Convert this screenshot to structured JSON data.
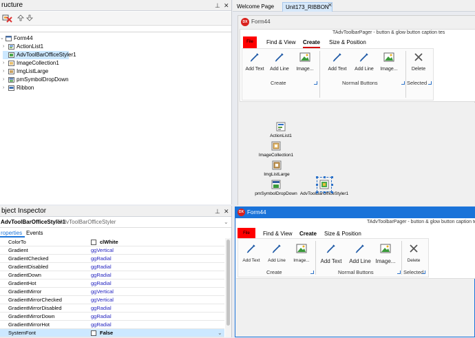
{
  "structure": {
    "title": "ructure",
    "toolbar_icons": [
      "add-icon",
      "delete-icon",
      "move-up-icon",
      "move-down-icon"
    ],
    "tree": [
      {
        "label": "Form44",
        "level": 0,
        "expand": "⌄",
        "icon": "form-icon"
      },
      {
        "label": "ActionList1",
        "level": 1,
        "expand": "›",
        "icon": "actionlist-icon"
      },
      {
        "label": "AdvToolBarOfficeStyler1",
        "level": 1,
        "expand": "",
        "icon": "styler-icon",
        "selected": true
      },
      {
        "label": "ImageCollection1",
        "level": 1,
        "expand": "›",
        "icon": "imagecollection-icon"
      },
      {
        "label": "ImgListLarge",
        "level": 1,
        "expand": "›",
        "icon": "imagelist-icon"
      },
      {
        "label": "pmSymbolDropDown",
        "level": 1,
        "expand": "›",
        "icon": "popupmenu-icon"
      },
      {
        "label": "Ribbon",
        "level": 1,
        "expand": "›",
        "icon": "ribbon-icon"
      }
    ]
  },
  "inspector": {
    "title": "bject Inspector",
    "selected_object": "AdvToolBarOfficeStyler1",
    "selected_type": "TAdvToolBarOfficeStyler",
    "tab_properties": "roperties",
    "tab_events": "Events",
    "rows": [
      {
        "name": "ColorTo",
        "value": "clWhite",
        "checkbox": true,
        "bold": true
      },
      {
        "name": "Gradient",
        "value": "ggVertical"
      },
      {
        "name": "GradientChecked",
        "value": "ggRadial"
      },
      {
        "name": "GradientDisabled",
        "value": "ggRadial"
      },
      {
        "name": "GradientDown",
        "value": "ggRadial"
      },
      {
        "name": "GradientHot",
        "value": "ggRadial"
      },
      {
        "name": "GradientMirror",
        "value": "ggVertical"
      },
      {
        "name": "GradientMirrorChecked",
        "value": "ggVertical"
      },
      {
        "name": "GradientMirrorDisabled",
        "value": "ggRadial"
      },
      {
        "name": "GradientMirrorDown",
        "value": "ggRadial"
      },
      {
        "name": "GradientMirrorHot",
        "value": "ggRadial"
      },
      {
        "name": "SystemFont",
        "value": "False",
        "checkbox": true,
        "bold": true,
        "selected": true
      }
    ]
  },
  "editor": {
    "tabs": [
      "Welcome Page",
      "Unit173_RIBBON"
    ],
    "active_tab": 1
  },
  "designer_form": {
    "title": "Form44",
    "pager_caption": "TAdvToolbarPager - button & glow button caption tes",
    "ribbon_tabs": [
      "File",
      "Find & View",
      "Create",
      "Size & Position"
    ],
    "active_ribbon_tab": "Create",
    "groups": [
      {
        "label": "Create",
        "buttons": [
          "Add Text",
          "Add Line",
          "Image..."
        ]
      },
      {
        "label": "Normal Buttons",
        "buttons": [
          "Add Text",
          "Add Line",
          "Image..."
        ]
      },
      {
        "label": "Selected",
        "buttons": [
          "Delete"
        ]
      }
    ],
    "nonvisual": [
      {
        "label": "ActionList1",
        "icon": "actionlist-icon"
      },
      {
        "label": "ImageCollection1",
        "icon": "imagecollection-icon"
      },
      {
        "label": "ImgListLarge",
        "icon": "imagelist-icon"
      },
      {
        "label": "pmSymbolDropDown",
        "icon": "popupmenu-icon"
      },
      {
        "label": "AdvToolBarOfficeStyler1",
        "icon": "styler-icon"
      }
    ]
  },
  "runtime_form": {
    "title": "Form44",
    "pager_caption": "TAdvToolbarPager - button & glow button caption test",
    "ribbon_tabs": [
      "File",
      "Find & View",
      "Create",
      "Size & Position"
    ],
    "active_ribbon_tab": "Create",
    "groups": [
      {
        "label": "Create",
        "buttons": [
          "Add Text",
          "Add Line",
          "Image..."
        ]
      },
      {
        "label": "Normal Buttons",
        "buttons": [
          "Add Text",
          "Add Line",
          "Image..."
        ]
      },
      {
        "label": "Selected",
        "buttons": [
          "Delete"
        ]
      }
    ]
  },
  "colors": {
    "accent_blue": "#1a73d9",
    "file_tab_red": "#ff0000",
    "active_tab_underline": "#d40000",
    "selection": "#cce8ff",
    "value_blue": "#1f1fbf"
  }
}
